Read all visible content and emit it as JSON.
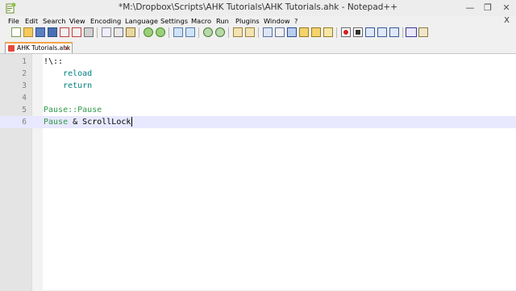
{
  "window": {
    "title": "*M:\\Dropbox\\Scripts\\AHK Tutorials\\AHK Tutorials.ahk - Notepad++",
    "controls": {
      "minimize": "—",
      "maximize": "❐",
      "close": "✕"
    }
  },
  "menu": {
    "items": [
      "File",
      "Edit",
      "Search",
      "View",
      "Encoding",
      "Language",
      "Settings",
      "Macro",
      "Run",
      "Plugins",
      "Window",
      "?"
    ],
    "close_label": "X"
  },
  "toolbar": {
    "icons": [
      "new-file-icon",
      "open-file-icon",
      "save-icon",
      "save-all-icon",
      "close-icon",
      "close-all-icon",
      "print-icon",
      "cut-icon",
      "copy-icon",
      "paste-icon",
      "undo-icon",
      "redo-icon",
      "find-icon",
      "replace-icon",
      "zoom-in-icon",
      "zoom-out-icon",
      "sync-vertical-icon",
      "sync-horizontal-icon",
      "word-wrap-icon",
      "all-characters-icon",
      "indent-guide-icon",
      "function-list-icon",
      "document-map-icon",
      "record-macro-icon",
      "stop-macro-icon",
      "play-macro-icon",
      "run-macro-multiple-icon",
      "save-macro-icon",
      "spell-check-icon",
      "plugin-icon"
    ]
  },
  "tabs": [
    {
      "label": "AHK Tutorials.ahk",
      "close": "x"
    }
  ],
  "editor": {
    "lines": [
      {
        "num": "1",
        "tokens": [
          {
            "text": "!\\::",
            "cls": "op"
          }
        ]
      },
      {
        "num": "2",
        "tokens": [
          {
            "text": "    reload",
            "cls": "kw"
          }
        ]
      },
      {
        "num": "3",
        "tokens": [
          {
            "text": "    return",
            "cls": "kw"
          }
        ]
      },
      {
        "num": "4",
        "tokens": []
      },
      {
        "num": "5",
        "tokens": [
          {
            "text": "Pause::Pause",
            "cls": "lbl"
          }
        ]
      },
      {
        "num": "6",
        "tokens": [
          {
            "text": "Pause",
            "cls": "lbl"
          },
          {
            "text": " & ",
            "cls": "op"
          },
          {
            "text": "ScrollLock",
            "cls": "op"
          }
        ],
        "current": true
      }
    ]
  }
}
